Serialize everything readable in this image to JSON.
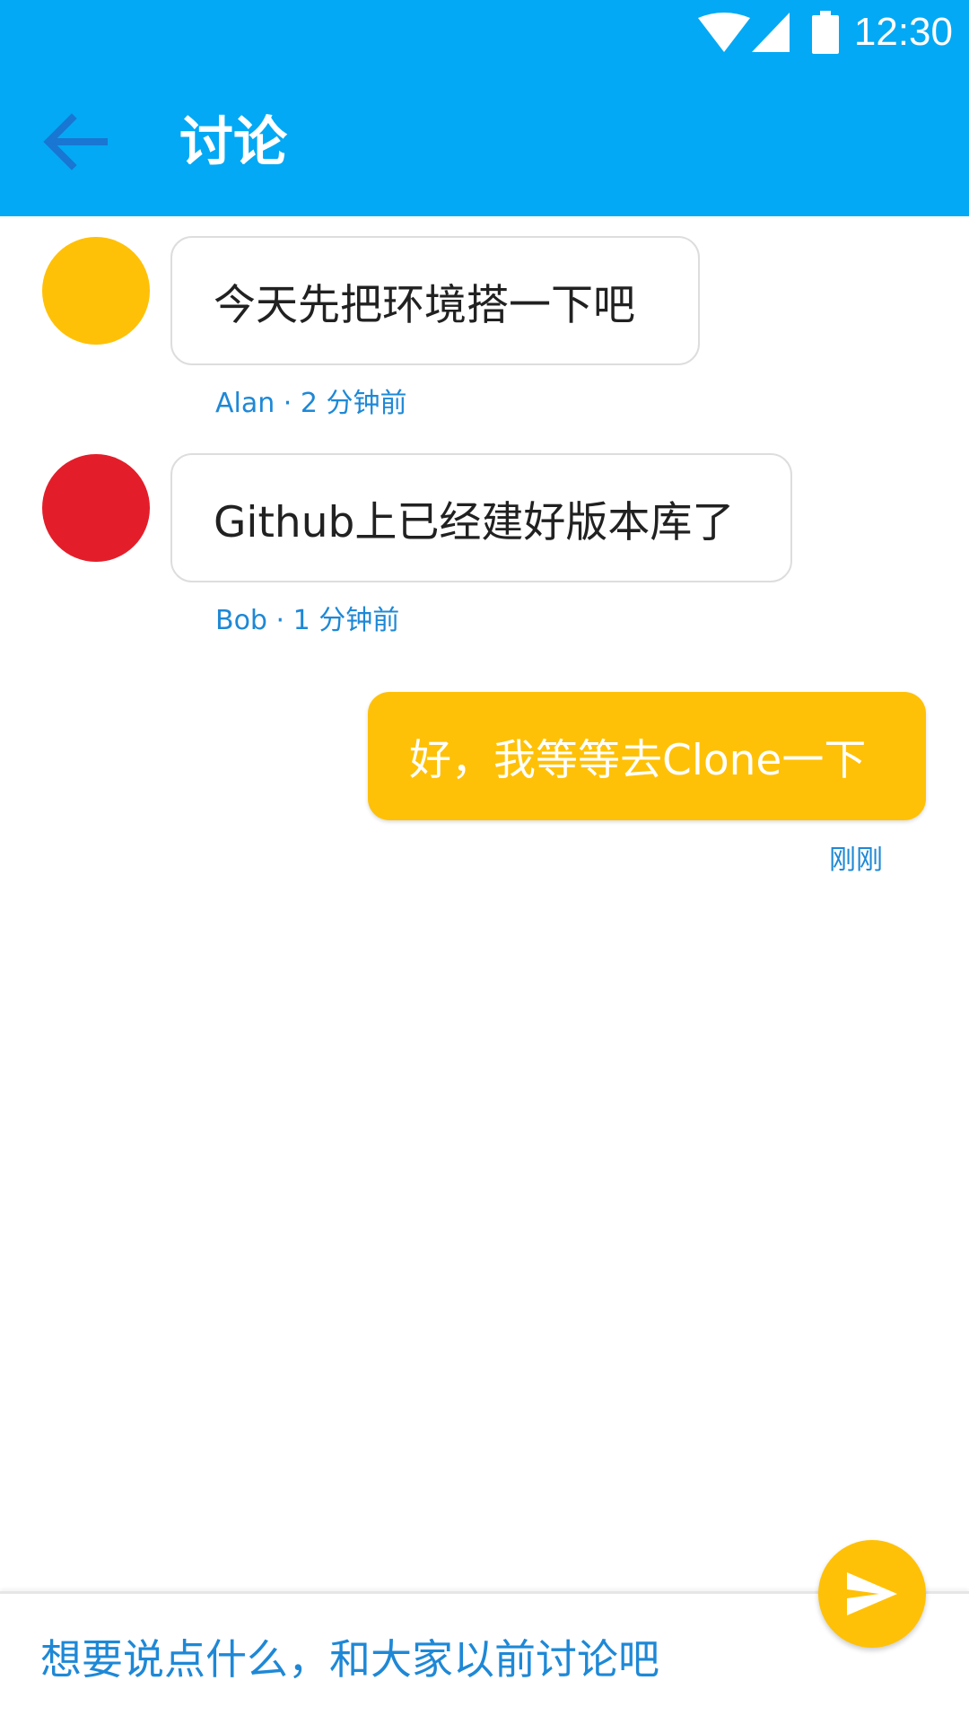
{
  "status_bar": {
    "time": "12:30",
    "icons": [
      "wifi-icon",
      "signal-icon",
      "battery-icon"
    ]
  },
  "app_bar": {
    "back_icon": "arrow-back-icon",
    "title": "讨论"
  },
  "messages": [
    {
      "text": "今天先把环境搭一下吧",
      "meta": "Alan · 2 分钟前",
      "avatar_color": "#FFC107",
      "outgoing": false
    },
    {
      "text": "Github上已经建好版本库了",
      "meta": "Bob · 1 分钟前",
      "avatar_color": "#E31E2A",
      "outgoing": false
    },
    {
      "text": "好，我等等去Clone一下",
      "meta": "刚刚",
      "outgoing": true
    }
  ],
  "input": {
    "placeholder": "想要说点什么，和大家以前讨论吧",
    "value": ""
  },
  "send_button": {
    "icon": "send-icon"
  },
  "colors": {
    "primary": "#03A9F4",
    "accent": "#FFC107",
    "meta_text": "#1E88D6",
    "back_arrow": "#1976D2"
  }
}
